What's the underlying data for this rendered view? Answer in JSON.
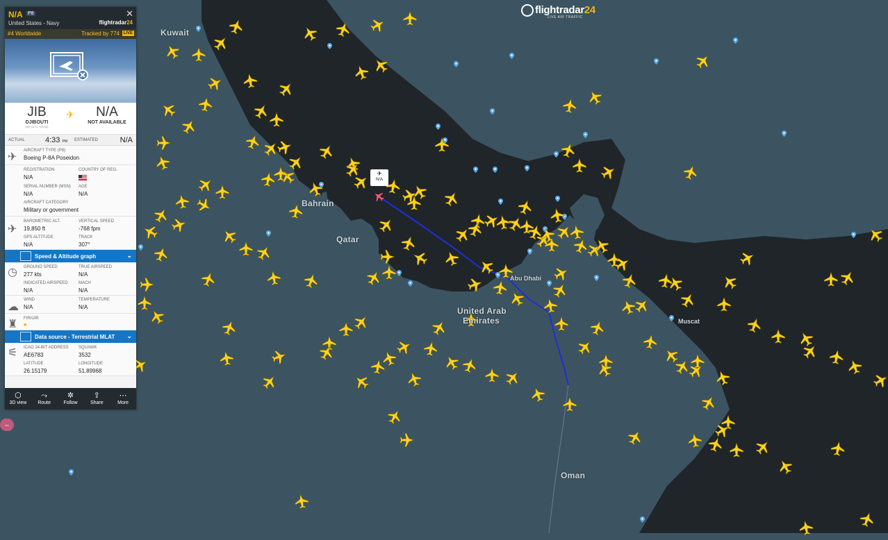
{
  "brand": {
    "name_a": "flightradar",
    "name_b": "24",
    "tagline": "LIVE AIR TRAFFIC"
  },
  "panel": {
    "callsign": "N/A",
    "type_badge": "P8",
    "operator": "United States - Navy",
    "brand_a": "flightradar",
    "brand_b": "24",
    "close_icon": "✕",
    "rank": "#4 Worldwide",
    "tracked_by": "Tracked by 774",
    "live": "LIVE",
    "origin": {
      "code": "JIB",
      "city": "DJIBOUTI",
      "tz": "EAT (UTC +03:00)"
    },
    "destination": {
      "code": "N/A",
      "city": "NOT AVAILABLE"
    },
    "times": {
      "actual_label": "ACTUAL",
      "actual_value": "4:33",
      "actual_suffix": "PM",
      "estimated_label": "ESTIMATED",
      "estimated_value": "N/A"
    },
    "aircraft_type": {
      "label": "AIRCRAFT TYPE (P8)",
      "value": "Boeing P-8A Poseidon"
    },
    "registration": {
      "label": "REGISTRATION",
      "value": "N/A"
    },
    "country": {
      "label": "COUNTRY OF REG."
    },
    "serial": {
      "label": "SERIAL NUMBER (MSN)",
      "value": "N/A"
    },
    "age": {
      "label": "AGE",
      "value": "N/A"
    },
    "category": {
      "label": "AIRCRAFT CATEGORY",
      "value": "Military or government"
    },
    "baro_alt": {
      "label": "BAROMETRIC ALT.",
      "value": "19,850 ft"
    },
    "vert_speed": {
      "label": "VERTICAL SPEED",
      "value": "-768 fpm"
    },
    "gps_alt": {
      "label": "GPS ALTITUDE",
      "value": "N/A"
    },
    "track": {
      "label": "TRACK",
      "value": "307°"
    },
    "speed_graph": "Speed & Altitude graph",
    "ground_speed": {
      "label": "GROUND SPEED",
      "value": "277 kts"
    },
    "true_airspeed": {
      "label": "TRUE AIRSPEED",
      "value": "N/A"
    },
    "ind_airspeed": {
      "label": "INDICATED AIRSPEED",
      "value": "N/A"
    },
    "mach": {
      "label": "MACH",
      "value": "N/A"
    },
    "wind": {
      "label": "WIND",
      "value": "N/A"
    },
    "temperature": {
      "label": "TEMPERATURE",
      "value": "N/A"
    },
    "fir": {
      "label": "FIR/UIR"
    },
    "data_source": "Data source - Terrestrial MLAT",
    "icao": {
      "label": "ICAO 24-BIT ADDRESS",
      "value": "AE6783"
    },
    "squawk": {
      "label": "SQUAWK",
      "value": "3532"
    },
    "latitude": {
      "label": "LATITUDE",
      "value": "26.15179"
    },
    "longitude": {
      "label": "LONGITUDE",
      "value": "51.89968"
    },
    "footer": [
      {
        "label": "3D view",
        "icon": "cube-icon"
      },
      {
        "label": "Route",
        "icon": "route-icon"
      },
      {
        "label": "Follow",
        "icon": "follow-icon"
      },
      {
        "label": "Share",
        "icon": "share-icon"
      },
      {
        "label": "More",
        "icon": "more-icon"
      }
    ]
  },
  "selected_flight_label": "N/A",
  "map_labels": {
    "kuwait": "Kuwait",
    "bahrain": "Bahrain",
    "qatar": "Qatar",
    "uae_1": "United Arab",
    "uae_2": "Emirates",
    "oman": "Oman",
    "muscat": "Muscat",
    "abu_dhabi": "Abu Dhabi"
  },
  "colors": {
    "plane": "#ffd21e",
    "track": "#1f2fd8",
    "panel_bar": "#1476c6",
    "water": "#1f2529",
    "land": "#3c5461"
  }
}
